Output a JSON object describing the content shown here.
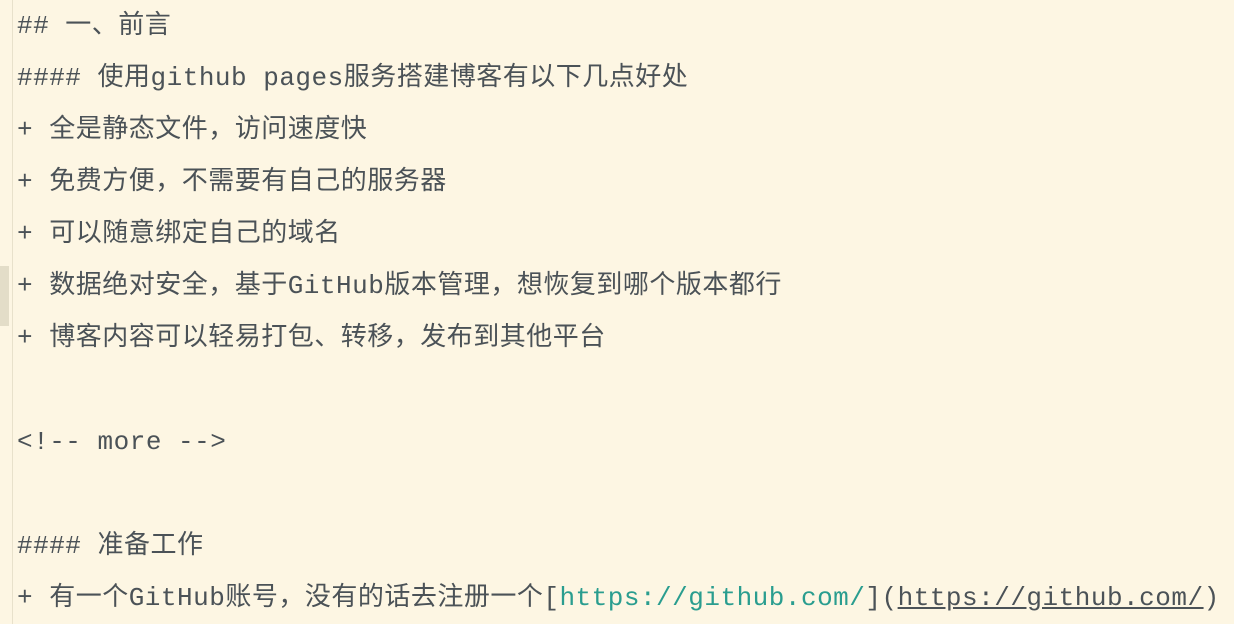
{
  "lines": {
    "l1": "## 一、前言",
    "l2": "#### 使用github pages服务搭建博客有以下几点好处",
    "l3": "+ 全是静态文件，访问速度快",
    "l4": "+ 免费方便，不需要有自己的服务器",
    "l5": "+ 可以随意绑定自己的域名",
    "l6": "+ 数据绝对安全，基于GitHub版本管理，想恢复到哪个版本都行",
    "l7": "+ 博客内容可以轻易打包、转移，发布到其他平台",
    "l8": "",
    "l9": "<!-- more -->",
    "l10": "",
    "l11": "#### 准备工作"
  },
  "last_line": {
    "prefix": "+ 有一个GitHub账号，没有的话去注册一个",
    "open_bracket": "[",
    "link_text": "https://github.com/",
    "mid": "](",
    "link_url": "https://github.com/",
    "close_paren": ")"
  },
  "colors": {
    "background": "#fdf6e3",
    "text": "#4b5257",
    "link": "#2a9d8f"
  }
}
